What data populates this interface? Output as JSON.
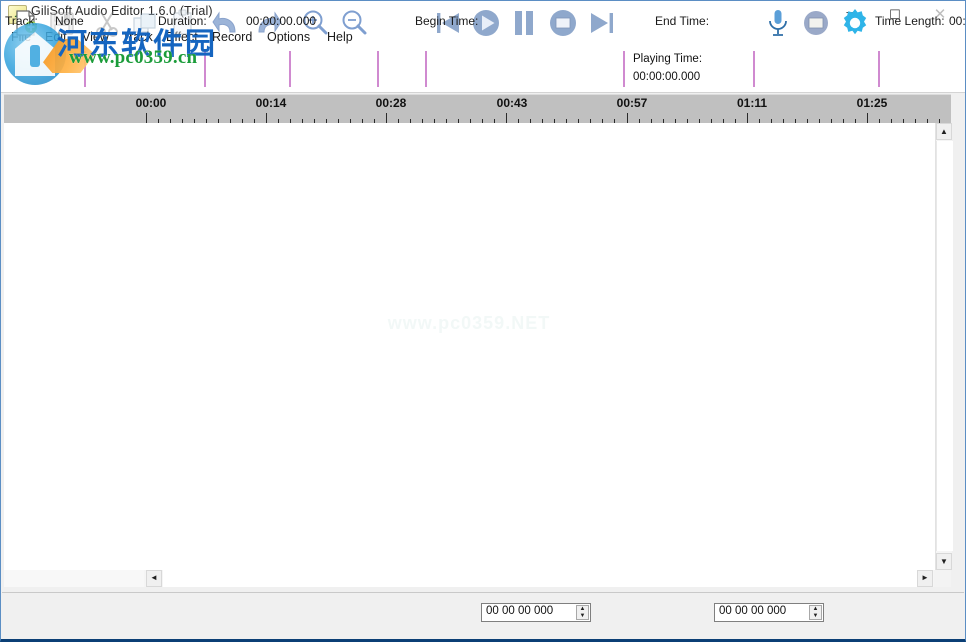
{
  "window": {
    "title": "GiliSoft Audio Editor 1.6.0 (Trial)",
    "app_icon": "music-note-icon",
    "minimize_label": "–",
    "maximize_label": "☐",
    "close_label": "✕"
  },
  "menu": {
    "items": [
      {
        "label": "File"
      },
      {
        "label": "Edit"
      },
      {
        "label": "View"
      },
      {
        "label": "Track"
      },
      {
        "label": "Effect"
      },
      {
        "label": "Record"
      },
      {
        "label": "Options"
      },
      {
        "label": "Help"
      }
    ]
  },
  "toolbar": {
    "buttons": [
      {
        "name": "new-file-icon",
        "tooltip": "New"
      },
      {
        "name": "save-icon",
        "tooltip": "Save"
      },
      {
        "name": "cut-icon",
        "tooltip": "Cut"
      },
      {
        "name": "copy-icon",
        "tooltip": "Copy"
      },
      {
        "name": "paste-icon",
        "tooltip": "Paste"
      },
      {
        "name": "undo-icon",
        "tooltip": "Undo"
      },
      {
        "name": "redo-icon",
        "tooltip": "Redo"
      },
      {
        "name": "zoom-in-icon",
        "tooltip": "Zoom In"
      },
      {
        "name": "zoom-out-icon",
        "tooltip": "Zoom Out"
      },
      {
        "name": "previous-icon",
        "tooltip": "Previous"
      },
      {
        "name": "play-icon",
        "tooltip": "Play"
      },
      {
        "name": "pause-icon",
        "tooltip": "Pause"
      },
      {
        "name": "stop-icon",
        "tooltip": "Stop"
      },
      {
        "name": "next-icon",
        "tooltip": "Next"
      },
      {
        "name": "microphone-icon",
        "tooltip": "Record"
      },
      {
        "name": "stop-record-icon",
        "tooltip": "Stop Record"
      },
      {
        "name": "settings-gear-icon",
        "tooltip": "Settings"
      }
    ],
    "playing_time_label": "Playing Time:",
    "playing_time_value": "00:00:00.000"
  },
  "timeline": {
    "labels": [
      "00:00",
      "00:14",
      "00:28",
      "00:43",
      "00:57",
      "01:11",
      "01:25"
    ],
    "label_x": [
      150,
      270,
      390,
      511,
      631,
      751,
      871
    ],
    "major_tick_x": [
      145,
      265,
      385,
      505,
      626,
      746,
      866
    ],
    "minor_spacing": 12.05,
    "minor_per_major": 10
  },
  "canvas": {
    "watermark": "www.pc0359.NET"
  },
  "watermark": {
    "site_cn": "河东软件园",
    "site_url": "www.pc0359.cn"
  },
  "scrollbars": {
    "v_up": "▲",
    "v_down": "▼",
    "h_left": "◄",
    "h_right": "►"
  },
  "status": {
    "track_label": "Track:",
    "track_value": "None",
    "duration_label": "Duration:",
    "duration_value": "00:00:00.000",
    "begin_time_label": "Begin Time:",
    "begin_time_value": "00 00 00 000",
    "end_time_label": "End Time:",
    "end_time_value": "00 00 00 000",
    "time_length_label": "Time Length:",
    "time_length_value": "00:"
  },
  "colors": {
    "separator": "#d08ad0",
    "ruler_bg": "#c0c0c0",
    "accent_blue": "#5b8ec4",
    "watermark_cn": "#1565c0",
    "watermark_url": "#1b9c3a"
  }
}
